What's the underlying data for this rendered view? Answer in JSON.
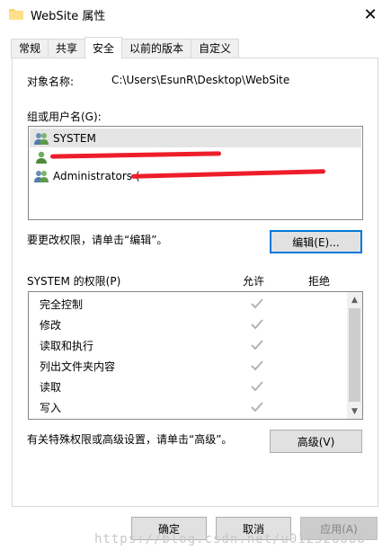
{
  "window": {
    "title": "WebSite 属性",
    "close_icon": "close-icon"
  },
  "tabs": [
    {
      "label": "常规",
      "active": false
    },
    {
      "label": "共享",
      "active": false
    },
    {
      "label": "安全",
      "active": true
    },
    {
      "label": "以前的版本",
      "active": false
    },
    {
      "label": "自定义",
      "active": false
    }
  ],
  "object": {
    "label": "对象名称:",
    "value": "C:\\Users\\EsunR\\Desktop\\WebSite"
  },
  "groups": {
    "label": "组或用户名(G):",
    "users": [
      {
        "name": "SYSTEM",
        "selected": true,
        "icon": "user-group-icon"
      },
      {
        "name": "",
        "selected": false,
        "icon": "user-icon",
        "redacted": true
      },
      {
        "name": "Administrators (",
        "selected": false,
        "icon": "user-group-icon",
        "redacted": true
      }
    ]
  },
  "edit": {
    "hint": "要更改权限，请单击“编辑”。",
    "button": "编辑(E)..."
  },
  "permissions": {
    "label": "SYSTEM 的权限(P)",
    "allow_header": "允许",
    "deny_header": "拒绝",
    "rows": [
      {
        "name": "完全控制",
        "allow": true,
        "deny": false
      },
      {
        "name": "修改",
        "allow": true,
        "deny": false
      },
      {
        "name": "读取和执行",
        "allow": true,
        "deny": false
      },
      {
        "name": "列出文件夹内容",
        "allow": true,
        "deny": false
      },
      {
        "name": "读取",
        "allow": true,
        "deny": false
      },
      {
        "name": "写入",
        "allow": true,
        "deny": false
      }
    ]
  },
  "advanced": {
    "hint": "有关特殊权限或高级设置，请单击“高级”。",
    "button": "高级(V)"
  },
  "footer": {
    "ok": "确定",
    "cancel": "取消",
    "apply": "应用(A)"
  },
  "watermark": "https://blog.csdn.net/u012526888",
  "colors": {
    "focus": "#0078d7",
    "redaction": "#ee1d2b",
    "check": "#b4b4b4"
  }
}
